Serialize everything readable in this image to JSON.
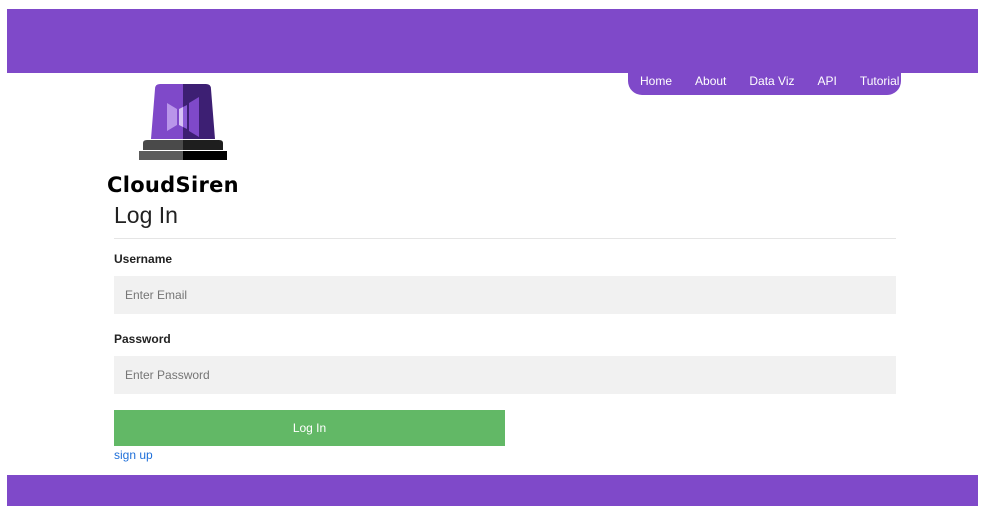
{
  "header": {
    "nav": [
      {
        "label": "Home"
      },
      {
        "label": "About"
      },
      {
        "label": "Data Viz"
      },
      {
        "label": "API"
      },
      {
        "label": "Tutorial"
      }
    ]
  },
  "brand": {
    "name": "CloudSiren",
    "logo_icon": "siren-icon"
  },
  "login": {
    "title": "Log In",
    "username_label": "Username",
    "username_placeholder": "Enter Email",
    "password_label": "Password",
    "password_placeholder": "Enter Password",
    "submit_label": "Log In",
    "signup_link": "sign up"
  },
  "colors": {
    "brand_purple": "#7f49c9",
    "button_green": "#62b866",
    "link_blue": "#1e6fd9",
    "field_bg": "#f1f1f1"
  }
}
